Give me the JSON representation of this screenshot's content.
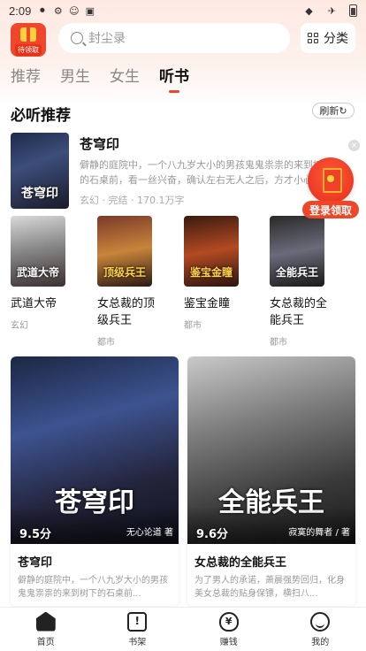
{
  "status_bar": {
    "time": "2:09"
  },
  "header": {
    "gift_label": "待领取",
    "search_placeholder": "封尘录",
    "category_label": "分类"
  },
  "tabs": [
    {
      "label": "推荐",
      "active": false
    },
    {
      "label": "男生",
      "active": false
    },
    {
      "label": "女生",
      "active": false
    },
    {
      "label": "听书",
      "active": true
    }
  ],
  "section": {
    "title": "必听推荐",
    "refresh_label": "刷新"
  },
  "featured": {
    "cover_text": "苍穹印",
    "title": "苍穹印",
    "desc": "僻静的庭院中，一个八九岁大小的男孩鬼鬼祟祟的来到树下的石桌前，看一丝兴奋，确认左右无人之后，方才小心翼翼的取出一本",
    "meta": "玄幻 · 完结 · 170.1万字"
  },
  "login_float": {
    "label": "登录领取"
  },
  "book_row": [
    {
      "cover_text": "武道大帝",
      "title": "武道大帝",
      "category": "玄幻"
    },
    {
      "cover_text": "顶级兵王",
      "title": "女总裁的顶级兵王",
      "category": "都市"
    },
    {
      "cover_text": "鉴宝金瞳",
      "title": "鉴宝金瞳",
      "category": "都市"
    },
    {
      "cover_text": "全能兵王",
      "title": "女总裁的全能兵王",
      "category": "都市"
    }
  ],
  "big_cards": [
    {
      "cover_text": "苍穹印",
      "rating": "9.5分",
      "author": "无心论道 著",
      "title": "苍穹印",
      "desc": "僻静的庭院中，一个八九岁大小的男孩鬼鬼祟祟的来到树下的石桌前..."
    },
    {
      "cover_text": "全能兵王",
      "rating": "9.6分",
      "author": "寂寞的舞者 / 著",
      "title": "女总裁的全能兵王",
      "desc": "为了男人的承诺，萧晨强势回归，化身美女总裁的贴身保镖，横扫八..."
    }
  ],
  "bottom_nav": [
    {
      "label": "首页",
      "icon": "home-icon"
    },
    {
      "label": "书架",
      "icon": "bookshelf-icon"
    },
    {
      "label": "赚钱",
      "icon": "money-bag-icon"
    },
    {
      "label": "我的",
      "icon": "profile-icon"
    }
  ],
  "colors": {
    "accent": "#f04628",
    "gift_yellow": "#ffd23c"
  }
}
